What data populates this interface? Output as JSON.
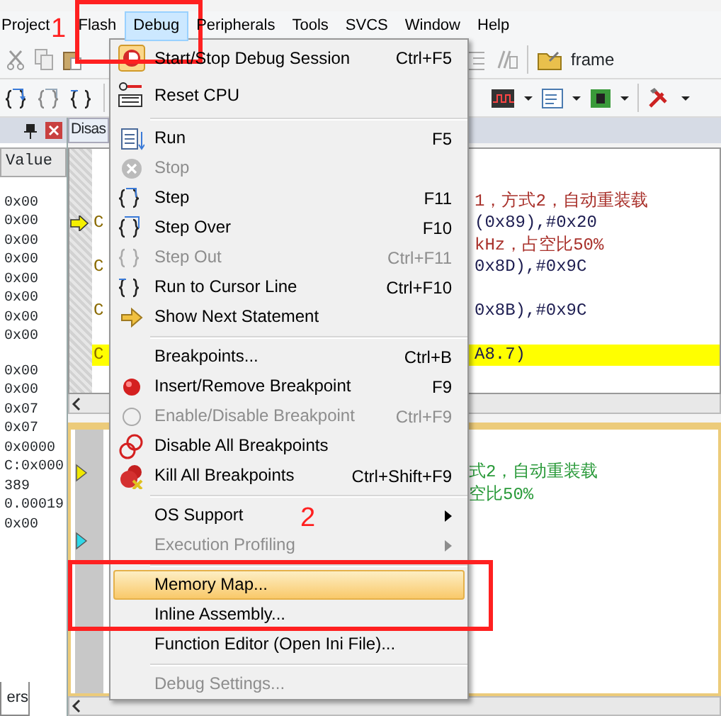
{
  "menubar": [
    {
      "label": "Project",
      "selected": false
    },
    {
      "label": "Flash",
      "selected": false
    },
    {
      "label": "Debug",
      "selected": true
    },
    {
      "label": "Peripherals",
      "selected": false
    },
    {
      "label": "Tools",
      "selected": false
    },
    {
      "label": "SVCS",
      "selected": false
    },
    {
      "label": "Window",
      "selected": false
    },
    {
      "label": "Help",
      "selected": false
    }
  ],
  "toolbar": {
    "target": "frame"
  },
  "watch": {
    "column": "Value",
    "value_groups": [
      [
        "0x00",
        "0x00",
        "0x00",
        "0x00",
        "0x00",
        "0x00",
        "0x00",
        "0x00"
      ],
      [
        "0x00",
        "0x00",
        "0x07",
        "0x07",
        "0x0000",
        "C:0x000",
        "389",
        "0.00019",
        "0x00"
      ]
    ],
    "bottom_tab": "ers"
  },
  "editor": {
    "tab": "Disas",
    "upper_lines": [
      {
        "kind": "comment",
        "text": "1，方式2，自动重装载",
        "current": false,
        "highlighted": false
      },
      {
        "kind": "code",
        "prefix": "C",
        "text": "(0x89),#0x20",
        "current": true,
        "highlighted": false
      },
      {
        "kind": "comment",
        "text": "kHz，占空比50%",
        "current": false,
        "highlighted": false
      },
      {
        "kind": "code",
        "prefix": "C",
        "text": "0x8D),#0x9C",
        "current": false,
        "highlighted": false
      },
      {
        "kind": "blank"
      },
      {
        "kind": "code",
        "prefix": "C",
        "text": "0x8B),#0x9C",
        "current": false,
        "highlighted": false
      },
      {
        "kind": "blank"
      },
      {
        "kind": "code",
        "prefix": "C",
        "text": "A8.7)",
        "current": false,
        "highlighted": true
      }
    ],
    "lower_lines": [
      {
        "kind": "current",
        "text": "式2，自动重装载"
      },
      {
        "kind": "plain",
        "text": "空比50%"
      },
      {
        "kind": "blank"
      },
      {
        "kind": "cursor"
      }
    ]
  },
  "debug_menu": [
    {
      "kind": "item",
      "label": "Start/Stop Debug Session",
      "shortcut": "Ctrl+F5",
      "disabled": false,
      "selected": false
    },
    {
      "kind": "item",
      "label": "Reset CPU",
      "disabled": false,
      "selected": false
    },
    {
      "kind": "separator"
    },
    {
      "kind": "item",
      "label": "Run",
      "shortcut": "F5",
      "disabled": false,
      "selected": false
    },
    {
      "kind": "item",
      "label": "Stop",
      "disabled": true,
      "selected": false
    },
    {
      "kind": "item",
      "label": "Step",
      "shortcut": "F11",
      "disabled": false,
      "selected": false
    },
    {
      "kind": "item",
      "label": "Step Over",
      "shortcut": "F10",
      "disabled": false,
      "selected": false
    },
    {
      "kind": "item",
      "label": "Step Out",
      "shortcut": "Ctrl+F11",
      "disabled": true,
      "selected": false
    },
    {
      "kind": "item",
      "label": "Run to Cursor Line",
      "shortcut": "Ctrl+F10",
      "disabled": false,
      "selected": false
    },
    {
      "kind": "item",
      "label": "Show Next Statement",
      "disabled": false,
      "selected": false
    },
    {
      "kind": "separator"
    },
    {
      "kind": "item",
      "label": "Breakpoints...",
      "shortcut": "Ctrl+B",
      "disabled": false,
      "selected": false
    },
    {
      "kind": "item",
      "label": "Insert/Remove Breakpoint",
      "shortcut": "F9",
      "disabled": false,
      "selected": false
    },
    {
      "kind": "item",
      "label": "Enable/Disable Breakpoint",
      "shortcut": "Ctrl+F9",
      "disabled": true,
      "selected": false
    },
    {
      "kind": "item",
      "label": "Disable All Breakpoints",
      "disabled": false,
      "selected": false
    },
    {
      "kind": "item",
      "label": "Kill All Breakpoints",
      "shortcut": "Ctrl+Shift+F9",
      "disabled": false,
      "selected": false
    },
    {
      "kind": "separator"
    },
    {
      "kind": "item",
      "label": "OS Support",
      "submenu": true,
      "disabled": false,
      "selected": false
    },
    {
      "kind": "item",
      "label": "Execution Profiling",
      "submenu": true,
      "disabled": true,
      "selected": false
    },
    {
      "kind": "separator"
    },
    {
      "kind": "item",
      "label": "Memory Map...",
      "disabled": false,
      "selected": true
    },
    {
      "kind": "item",
      "label": "Inline Assembly...",
      "disabled": false,
      "selected": false
    },
    {
      "kind": "item",
      "label": "Function Editor (Open Ini File)...",
      "disabled": false,
      "selected": false
    },
    {
      "kind": "separator"
    },
    {
      "kind": "item",
      "label": "Debug Settings...",
      "disabled": true,
      "selected": false
    }
  ],
  "callouts": [
    {
      "number": "1"
    },
    {
      "number": "2"
    }
  ]
}
